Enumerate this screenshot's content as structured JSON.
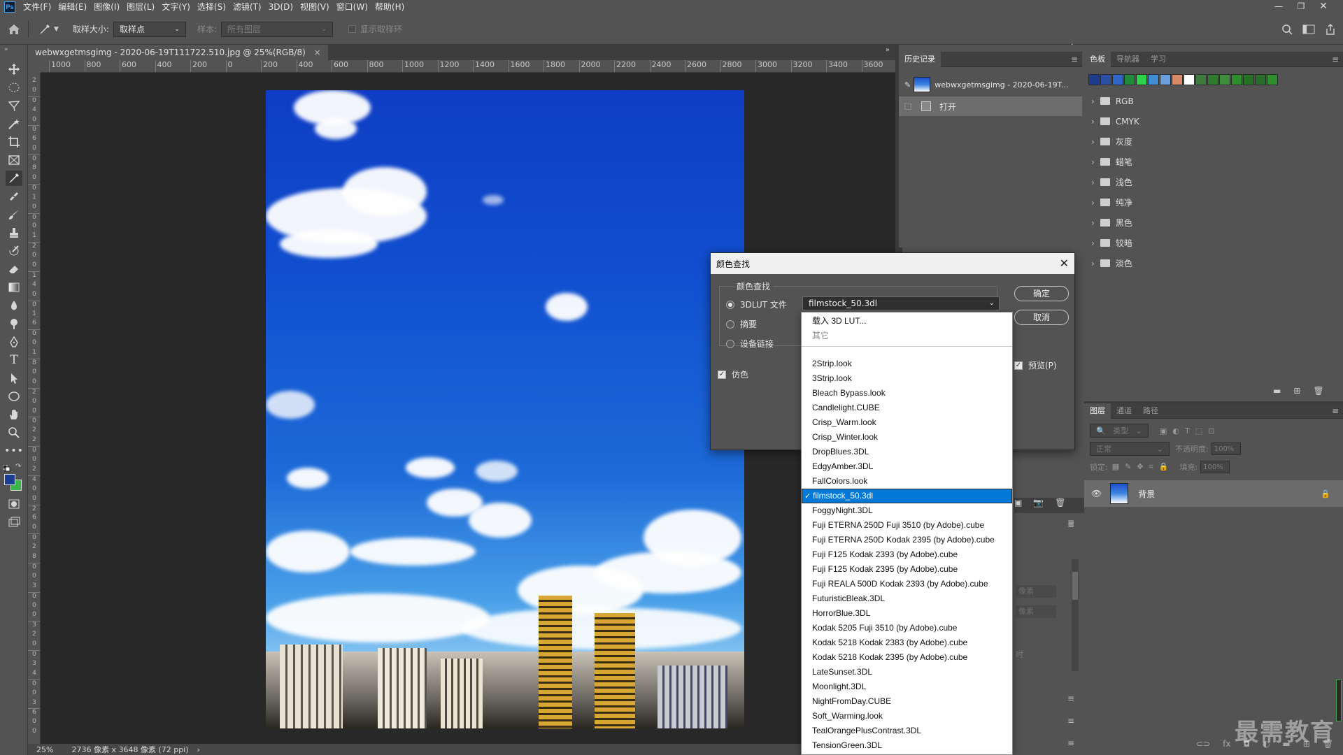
{
  "menubar": {
    "logo": "Ps",
    "items": [
      "文件(F)",
      "编辑(E)",
      "图像(I)",
      "图层(L)",
      "文字(Y)",
      "选择(S)",
      "滤镜(T)",
      "3D(D)",
      "视图(V)",
      "窗口(W)",
      "帮助(H)"
    ]
  },
  "options": {
    "sample_size_label": "取样大小:",
    "sample_size_value": "取样点",
    "sample_label": "样本:",
    "sample_value": "所有图层",
    "show_ring_label": "显示取样环"
  },
  "document": {
    "tab_title": "webwxgetmsgimg - 2020-06-19T111722.510.jpg @ 25%(RGB/8)",
    "close_glyph": "×",
    "ruler_h": [
      "1000",
      "800",
      "600",
      "400",
      "200",
      "0",
      "200",
      "400",
      "600",
      "800",
      "1000",
      "1200",
      "1400",
      "1600",
      "1800",
      "2000",
      "2200",
      "2400",
      "2600",
      "2800",
      "3000",
      "3200",
      "3400",
      "3600"
    ],
    "ruler_v": [
      "0",
      "2",
      "0",
      "0",
      "4",
      "0",
      "0",
      "6",
      "0",
      "0",
      "8",
      "0",
      "0",
      "1",
      "0",
      "0",
      "0",
      "1",
      "2",
      "0",
      "0",
      "1",
      "4",
      "0",
      "0",
      "1",
      "6",
      "0",
      "0",
      "1",
      "8",
      "0",
      "0",
      "2",
      "0",
      "0",
      "0",
      "2",
      "2",
      "0",
      "0",
      "2",
      "4",
      "0",
      "0",
      "2",
      "6",
      "0",
      "0",
      "2",
      "8",
      "0",
      "0",
      "3",
      "0",
      "0",
      "0",
      "3",
      "2",
      "0",
      "0",
      "3",
      "4",
      "0",
      "0",
      "3",
      "6",
      "0",
      "0"
    ]
  },
  "status": {
    "zoom": "25%",
    "dimensions": "2736 像素 x 3648 像素 (72 ppi)",
    "arrow": "›"
  },
  "history": {
    "tab": "历史记录",
    "snapshot": "webwxgetmsgimg - 2020-06-19T...",
    "step": "打开"
  },
  "swatches": {
    "tabs": [
      "色板",
      "导航器",
      "学习"
    ],
    "colors": [
      "#1e3a8a",
      "#2a4fa3",
      "#2f66c8",
      "#1f8a3c",
      "#2bd24a",
      "#3f8fd2",
      "#6aa0da",
      "#d88a68",
      "#ffffff",
      "#3d7a3d",
      "#2f7a2f",
      "#3e8e3e",
      "#2e8b2e",
      "#257025",
      "#2b6b2b",
      "#2e8e2e"
    ],
    "groups": [
      "RGB",
      "CMYK",
      "灰度",
      "蜡笔",
      "浅色",
      "纯净",
      "黑色",
      "较暗",
      "淡色"
    ]
  },
  "layers": {
    "tabs": [
      "图层",
      "通道",
      "路径"
    ],
    "filter_placeholder": "类型",
    "blend_mode": "正常",
    "opacity_label": "不透明度:",
    "opacity_value": "100%",
    "lock_label": "锁定:",
    "fill_label": "填充:",
    "fill_value": "100%",
    "layer_name": "背景"
  },
  "mid_panel": {
    "label1": "像素",
    "label2": "像素",
    "label3": "时"
  },
  "dialog": {
    "title": "颜色查找",
    "group_title": "颜色查找",
    "options": [
      {
        "label": "3DLUT 文件",
        "selected": true
      },
      {
        "label": "摘要",
        "selected": false
      },
      {
        "label": "设备链接",
        "selected": false
      }
    ],
    "dither_label": "仿色",
    "preview_label": "预览(P)",
    "select_value": "filmstock_50.3dl",
    "ok_label": "确定",
    "cancel_label": "取消"
  },
  "dropdown": {
    "header_items": [
      "载入 3D LUT...",
      "其它"
    ],
    "items": [
      "2Strip.look",
      "3Strip.look",
      "Bleach Bypass.look",
      "Candlelight.CUBE",
      "Crisp_Warm.look",
      "Crisp_Winter.look",
      "DropBlues.3DL",
      "EdgyAmber.3DL",
      "FallColors.look",
      "filmstock_50.3dl",
      "FoggyNight.3DL",
      "Fuji ETERNA 250D Fuji 3510 (by Adobe).cube",
      "Fuji ETERNA 250D Kodak 2395 (by Adobe).cube",
      "Fuji F125 Kodak 2393 (by Adobe).cube",
      "Fuji F125 Kodak 2395 (by Adobe).cube",
      "Fuji REALA 500D Kodak 2393 (by Adobe).cube",
      "FuturisticBleak.3DL",
      "HorrorBlue.3DL",
      "Kodak 5205 Fuji 3510 (by Adobe).cube",
      "Kodak 5218 Kodak 2383 (by Adobe).cube",
      "Kodak 5218 Kodak 2395 (by Adobe).cube",
      "LateSunset.3DL",
      "Moonlight.3DL",
      "NightFromDay.CUBE",
      "Soft_Warming.look",
      "TealOrangePlusContrast.3DL",
      "TensionGreen.3DL"
    ],
    "selected_index": 9,
    "check_glyph": "✓"
  },
  "watermark": "最需教育"
}
